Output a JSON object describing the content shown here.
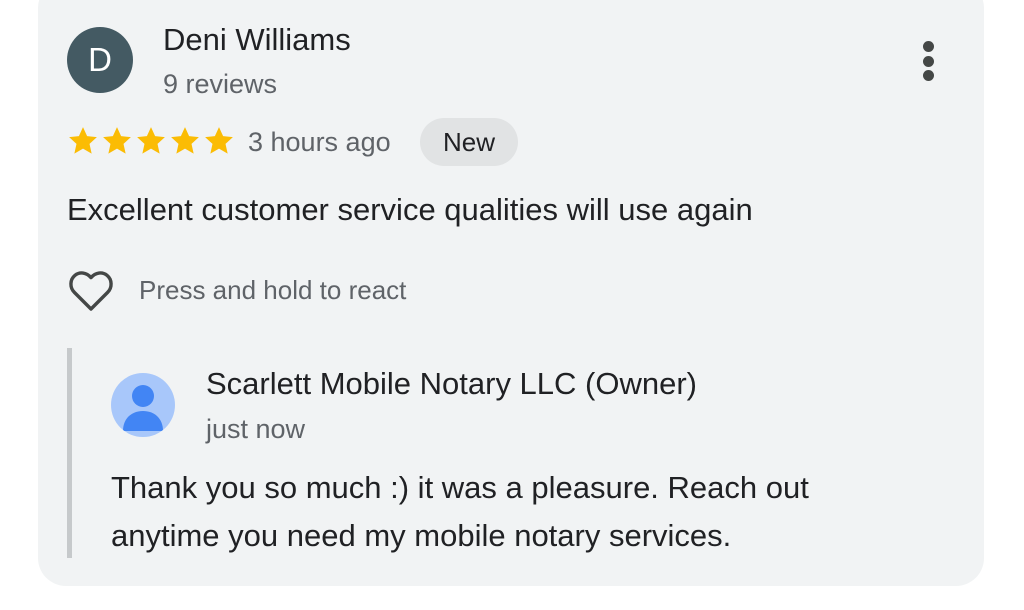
{
  "review": {
    "avatar_initial": "D",
    "avatar_color": "#445a63",
    "reviewer_name": "Deni Williams",
    "review_count": "9 reviews",
    "more_icon": "more-vert-icon",
    "rating": 5,
    "rating_max": 5,
    "star_color": "#fbbc04",
    "star_icon": "star-icon",
    "time_ago": "3 hours ago",
    "badge": "New",
    "text": "Excellent customer service qualities will use again",
    "react_icon": "heart-outline-icon",
    "react_hint": "Press and hold to react"
  },
  "owner_reply": {
    "avatar_icon": "person-icon",
    "avatar_color": "#a8c7fa",
    "name": "Scarlett Mobile Notary LLC (Owner)",
    "time_ago": "just now",
    "text": "Thank you so much :) it was a pleasure. Reach out anytime you need my mobile notary services."
  }
}
